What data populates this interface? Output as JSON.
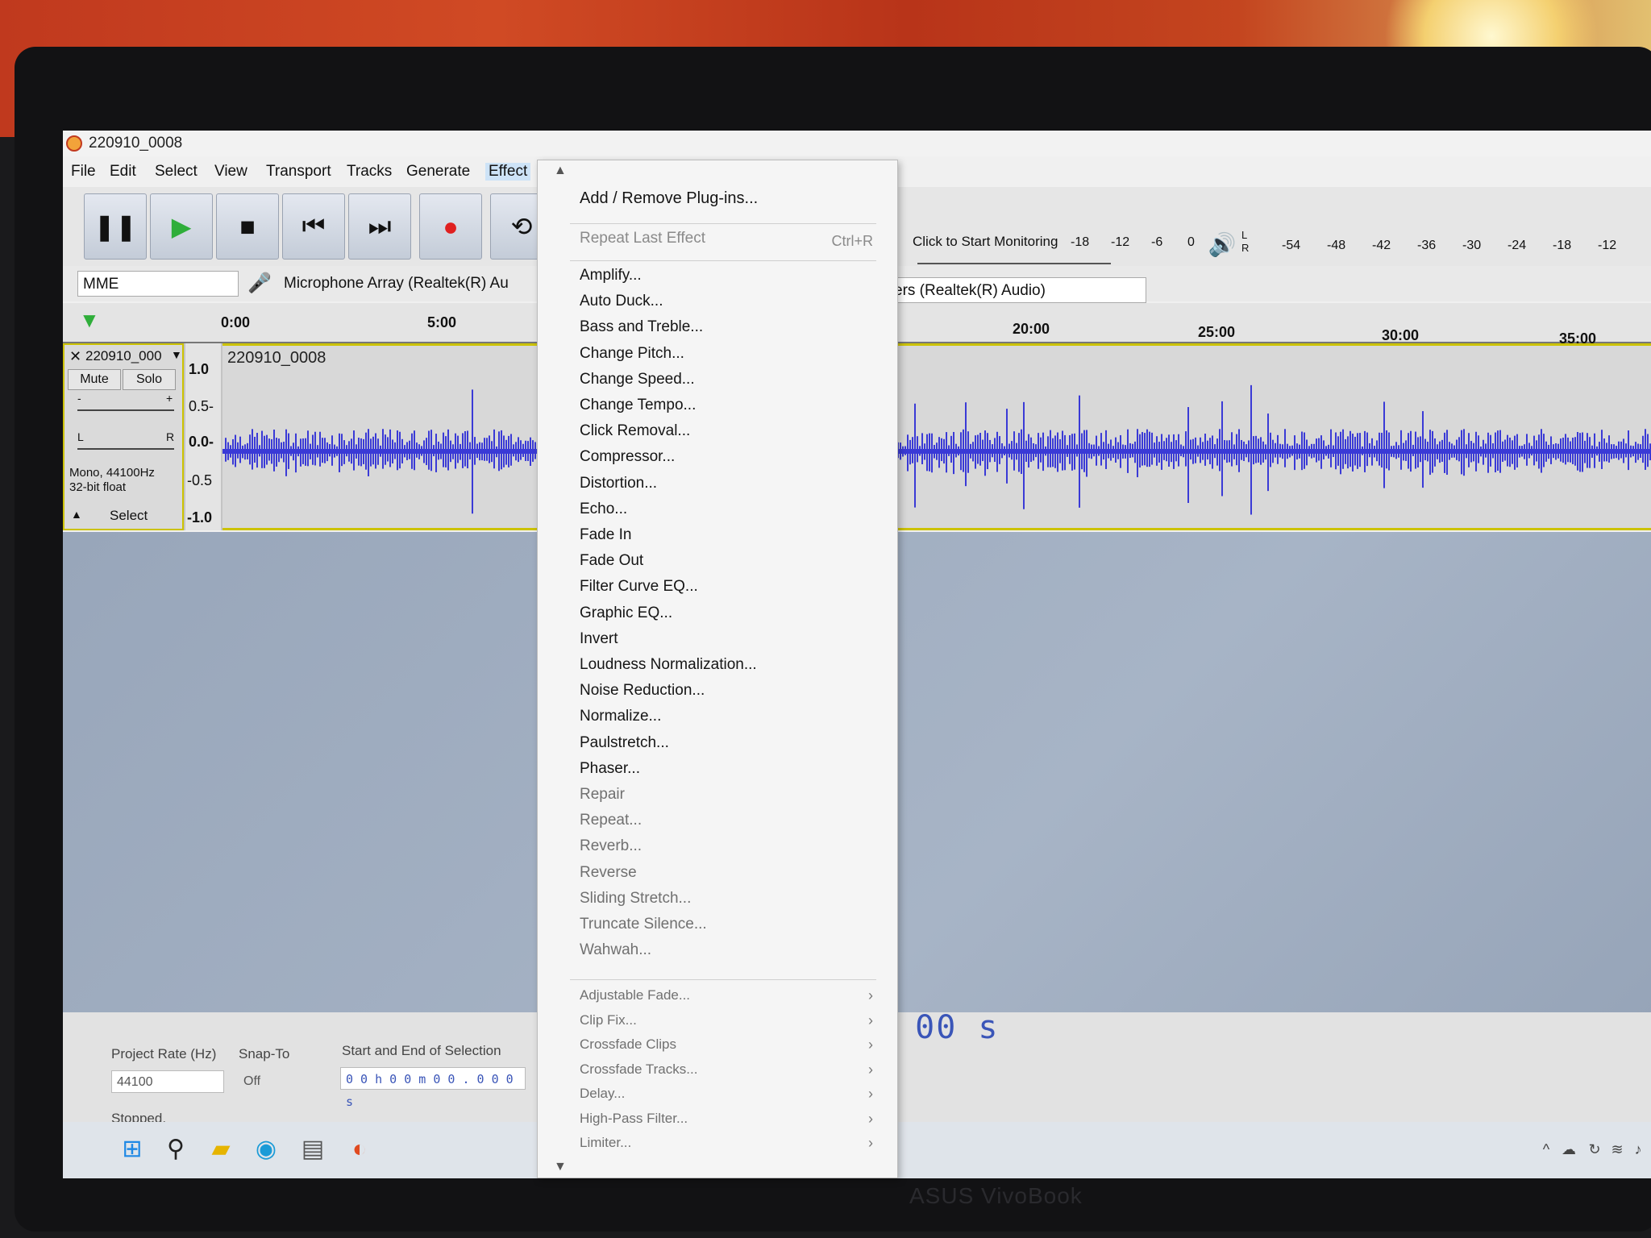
{
  "window": {
    "title": "220910_0008"
  },
  "menubar": [
    "File",
    "Edit",
    "Select",
    "View",
    "Transport",
    "Tracks",
    "Generate",
    "Effect"
  ],
  "meters": {
    "monitor_label": "Click to Start Monitoring",
    "record_ticks": [
      "-18",
      "-12",
      "-6",
      "0"
    ],
    "play_ticks": [
      "-54",
      "-48",
      "-42",
      "-36",
      "-30",
      "-24",
      "-18",
      "-12"
    ],
    "lr": [
      "L",
      "R"
    ]
  },
  "device": {
    "host": "MME",
    "input": "Microphone Array (Realtek(R) Au",
    "output": "ers (Realtek(R) Audio)"
  },
  "ruler": [
    "0:00",
    "5:00",
    "20:00",
    "25:00",
    "30:00",
    "35:00"
  ],
  "track": {
    "name": "220910_000",
    "mute": "Mute",
    "solo": "Solo",
    "gain_minus": "-",
    "gain_plus": "+",
    "pan_left": "L",
    "pan_right": "R",
    "format_line1": "Mono, 44100Hz",
    "format_line2": "32-bit float",
    "select": "Select",
    "clip_name": "220910_0008",
    "scale": [
      "1.0",
      "0.5-",
      "0.0-",
      "-0.5",
      "-1.0"
    ]
  },
  "status": {
    "project_rate_label": "Project Rate (Hz)",
    "project_rate_value": "44100",
    "snap_label": "Snap-To",
    "snap_value": "Off",
    "selection_label": "Start and End of Selection",
    "selection_value": "0 0 h 0 0 m 0 0 . 0 0 0 s",
    "state": "Stopped.",
    "big_time": "m 00 s"
  },
  "effect_menu": {
    "add_remove": "Add / Remove Plug-ins...",
    "repeat_last": "Repeat Last Effect",
    "repeat_shortcut": "Ctrl+R",
    "items": [
      "Amplify...",
      "Auto Duck...",
      "Bass and Treble...",
      "Change Pitch...",
      "Change Speed...",
      "Change Tempo...",
      "Click Removal...",
      "Compressor...",
      "Distortion...",
      "Echo...",
      "Fade In",
      "Fade Out",
      "Filter Curve EQ...",
      "Graphic EQ...",
      "Invert",
      "Loudness Normalization...",
      "Noise Reduction...",
      "Normalize...",
      "Paulstretch...",
      "Phaser...",
      "Repair",
      "Repeat...",
      "Reverb...",
      "Reverse",
      "Sliding Stretch...",
      "Truncate Silence...",
      "Wahwah..."
    ],
    "submenus": [
      "Adjustable Fade...",
      "Clip Fix...",
      "Crossfade Clips",
      "Crossfade Tracks...",
      "Delay...",
      "High-Pass Filter...",
      "Limiter..."
    ]
  },
  "laptop_brand": "ASUS VivoBook"
}
